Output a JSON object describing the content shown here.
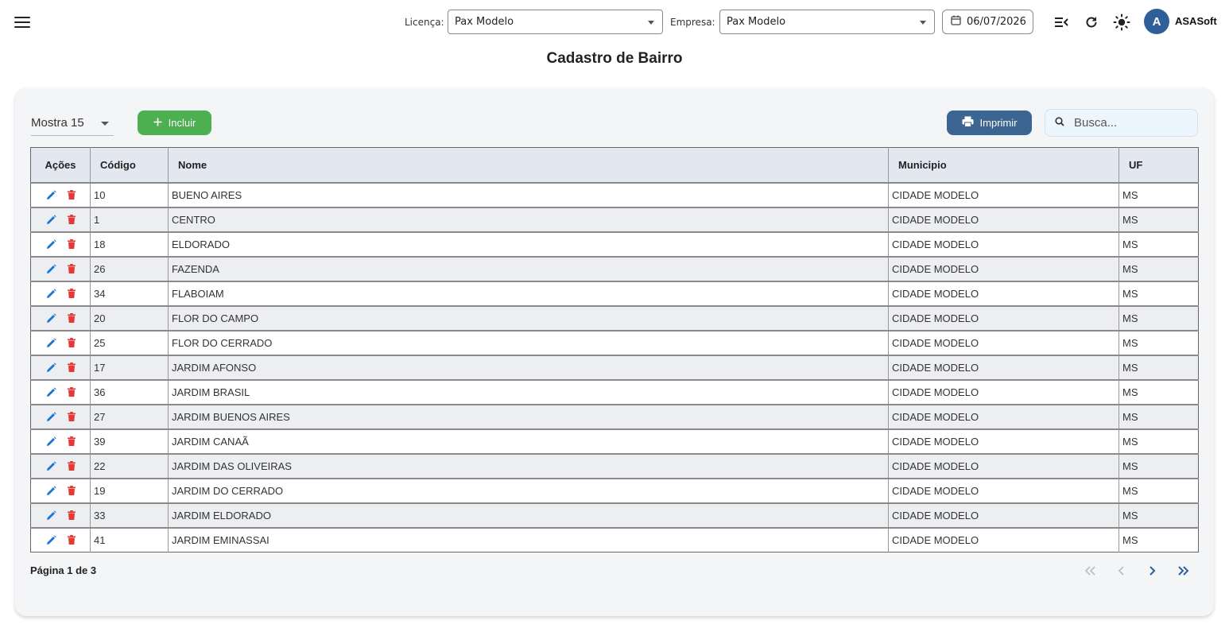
{
  "header": {
    "license_label": "Licença:",
    "license_value": "Pax Modelo",
    "company_label": "Empresa:",
    "company_value": "Pax Modelo",
    "date": "06/07/2026",
    "avatar_initial": "A",
    "brand": "ASASoft",
    "icons": [
      "menu-icon",
      "collapse-menu-icon",
      "refresh-icon",
      "sun-icon",
      "calendar-icon"
    ]
  },
  "page": {
    "title": "Cadastro de Bairro"
  },
  "toolbar": {
    "show_label": "Mostra 15",
    "add_label": "Incluir",
    "print_label": "Imprimir",
    "search_placeholder": "Busca..."
  },
  "table": {
    "columns": [
      "Ações",
      "Código",
      "Nome",
      "Municipio",
      "UF"
    ],
    "rows": [
      {
        "codigo": "10",
        "nome": "BUENO AIRES",
        "municipio": "CIDADE MODELO",
        "uf": "MS"
      },
      {
        "codigo": "1",
        "nome": "CENTRO",
        "municipio": "CIDADE MODELO",
        "uf": "MS"
      },
      {
        "codigo": "18",
        "nome": "ELDORADO",
        "municipio": "CIDADE MODELO",
        "uf": "MS"
      },
      {
        "codigo": "26",
        "nome": "FAZENDA",
        "municipio": "CIDADE MODELO",
        "uf": "MS"
      },
      {
        "codigo": "34",
        "nome": "FLABOIAM",
        "municipio": "CIDADE MODELO",
        "uf": "MS"
      },
      {
        "codigo": "20",
        "nome": "FLOR DO CAMPO",
        "municipio": "CIDADE MODELO",
        "uf": "MS"
      },
      {
        "codigo": "25",
        "nome": "FLOR DO CERRADO",
        "municipio": "CIDADE MODELO",
        "uf": "MS"
      },
      {
        "codigo": "17",
        "nome": "JARDIM AFONSO",
        "municipio": "CIDADE MODELO",
        "uf": "MS"
      },
      {
        "codigo": "36",
        "nome": "JARDIM BRASIL",
        "municipio": "CIDADE MODELO",
        "uf": "MS"
      },
      {
        "codigo": "27",
        "nome": "JARDIM BUENOS AIRES",
        "municipio": "CIDADE MODELO",
        "uf": "MS"
      },
      {
        "codigo": "39",
        "nome": "JARDIM CANAÃ",
        "municipio": "CIDADE MODELO",
        "uf": "MS"
      },
      {
        "codigo": "22",
        "nome": "JARDIM DAS OLIVEIRAS",
        "municipio": "CIDADE MODELO",
        "uf": "MS"
      },
      {
        "codigo": "19",
        "nome": "JARDIM DO CERRADO",
        "municipio": "CIDADE MODELO",
        "uf": "MS"
      },
      {
        "codigo": "33",
        "nome": "JARDIM ELDORADO",
        "municipio": "CIDADE MODELO",
        "uf": "MS"
      },
      {
        "codigo": "41",
        "nome": "JARDIM EMINASSAI",
        "municipio": "CIDADE MODELO",
        "uf": "MS"
      }
    ]
  },
  "pagination": {
    "info": "Página 1 de 3",
    "current_page": 1,
    "total_pages": 3
  },
  "colors": {
    "primary": "#3d6591",
    "success": "#4caf50",
    "edit_icon": "#1976d2",
    "delete_icon": "#e53935",
    "header_bg": "#e3e7ef"
  }
}
